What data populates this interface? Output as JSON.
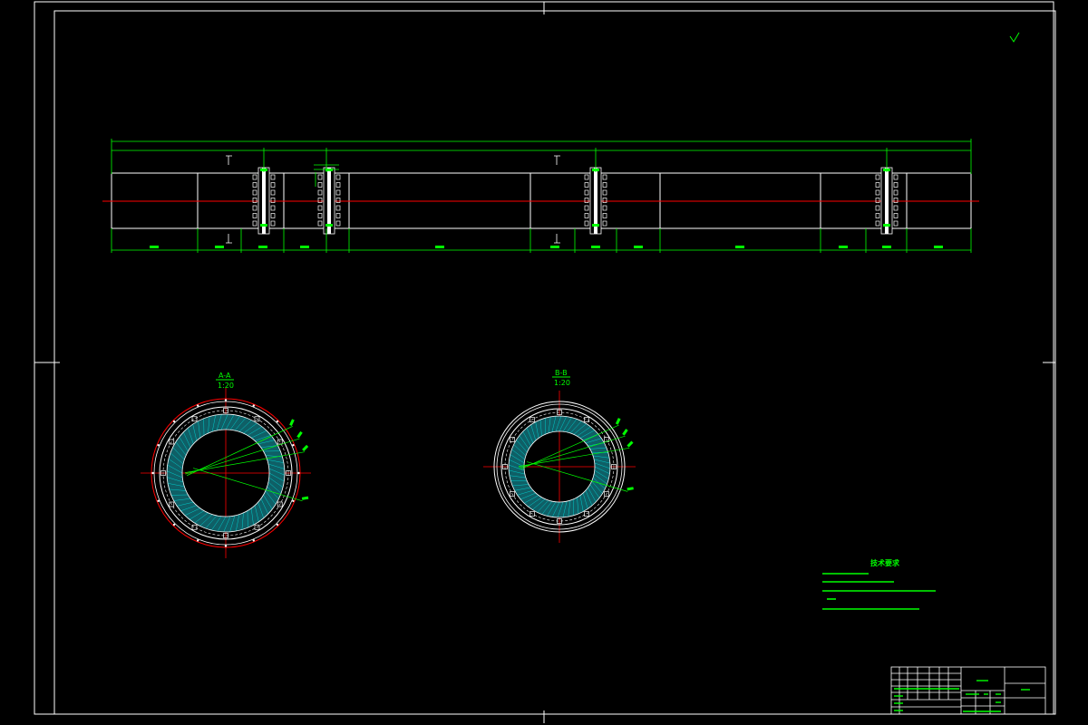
{
  "drawing": {
    "section_labels": [
      {
        "name": "A-A",
        "scale": "1:20"
      },
      {
        "name": "B-B",
        "scale": "1:20"
      }
    ],
    "roughness_mark": "",
    "dimensions": {
      "overall": "",
      "top_segments": [
        "",
        "",
        "",
        ""
      ],
      "bottom_segments": [
        "",
        "",
        "",
        "",
        "",
        "",
        "",
        "",
        "",
        "",
        "",
        ""
      ]
    },
    "technical_requirements": {
      "title": "技术要求",
      "items": [
        "",
        "",
        "",
        "",
        ""
      ]
    },
    "title_block": {
      "part_name": "",
      "drawing_code": ""
    }
  },
  "colors": {
    "frame": "#ffffff",
    "dimension": "#00ff00",
    "centerline": "#ff0000",
    "hatch": "#00ffff",
    "flange": "#ff0000"
  }
}
